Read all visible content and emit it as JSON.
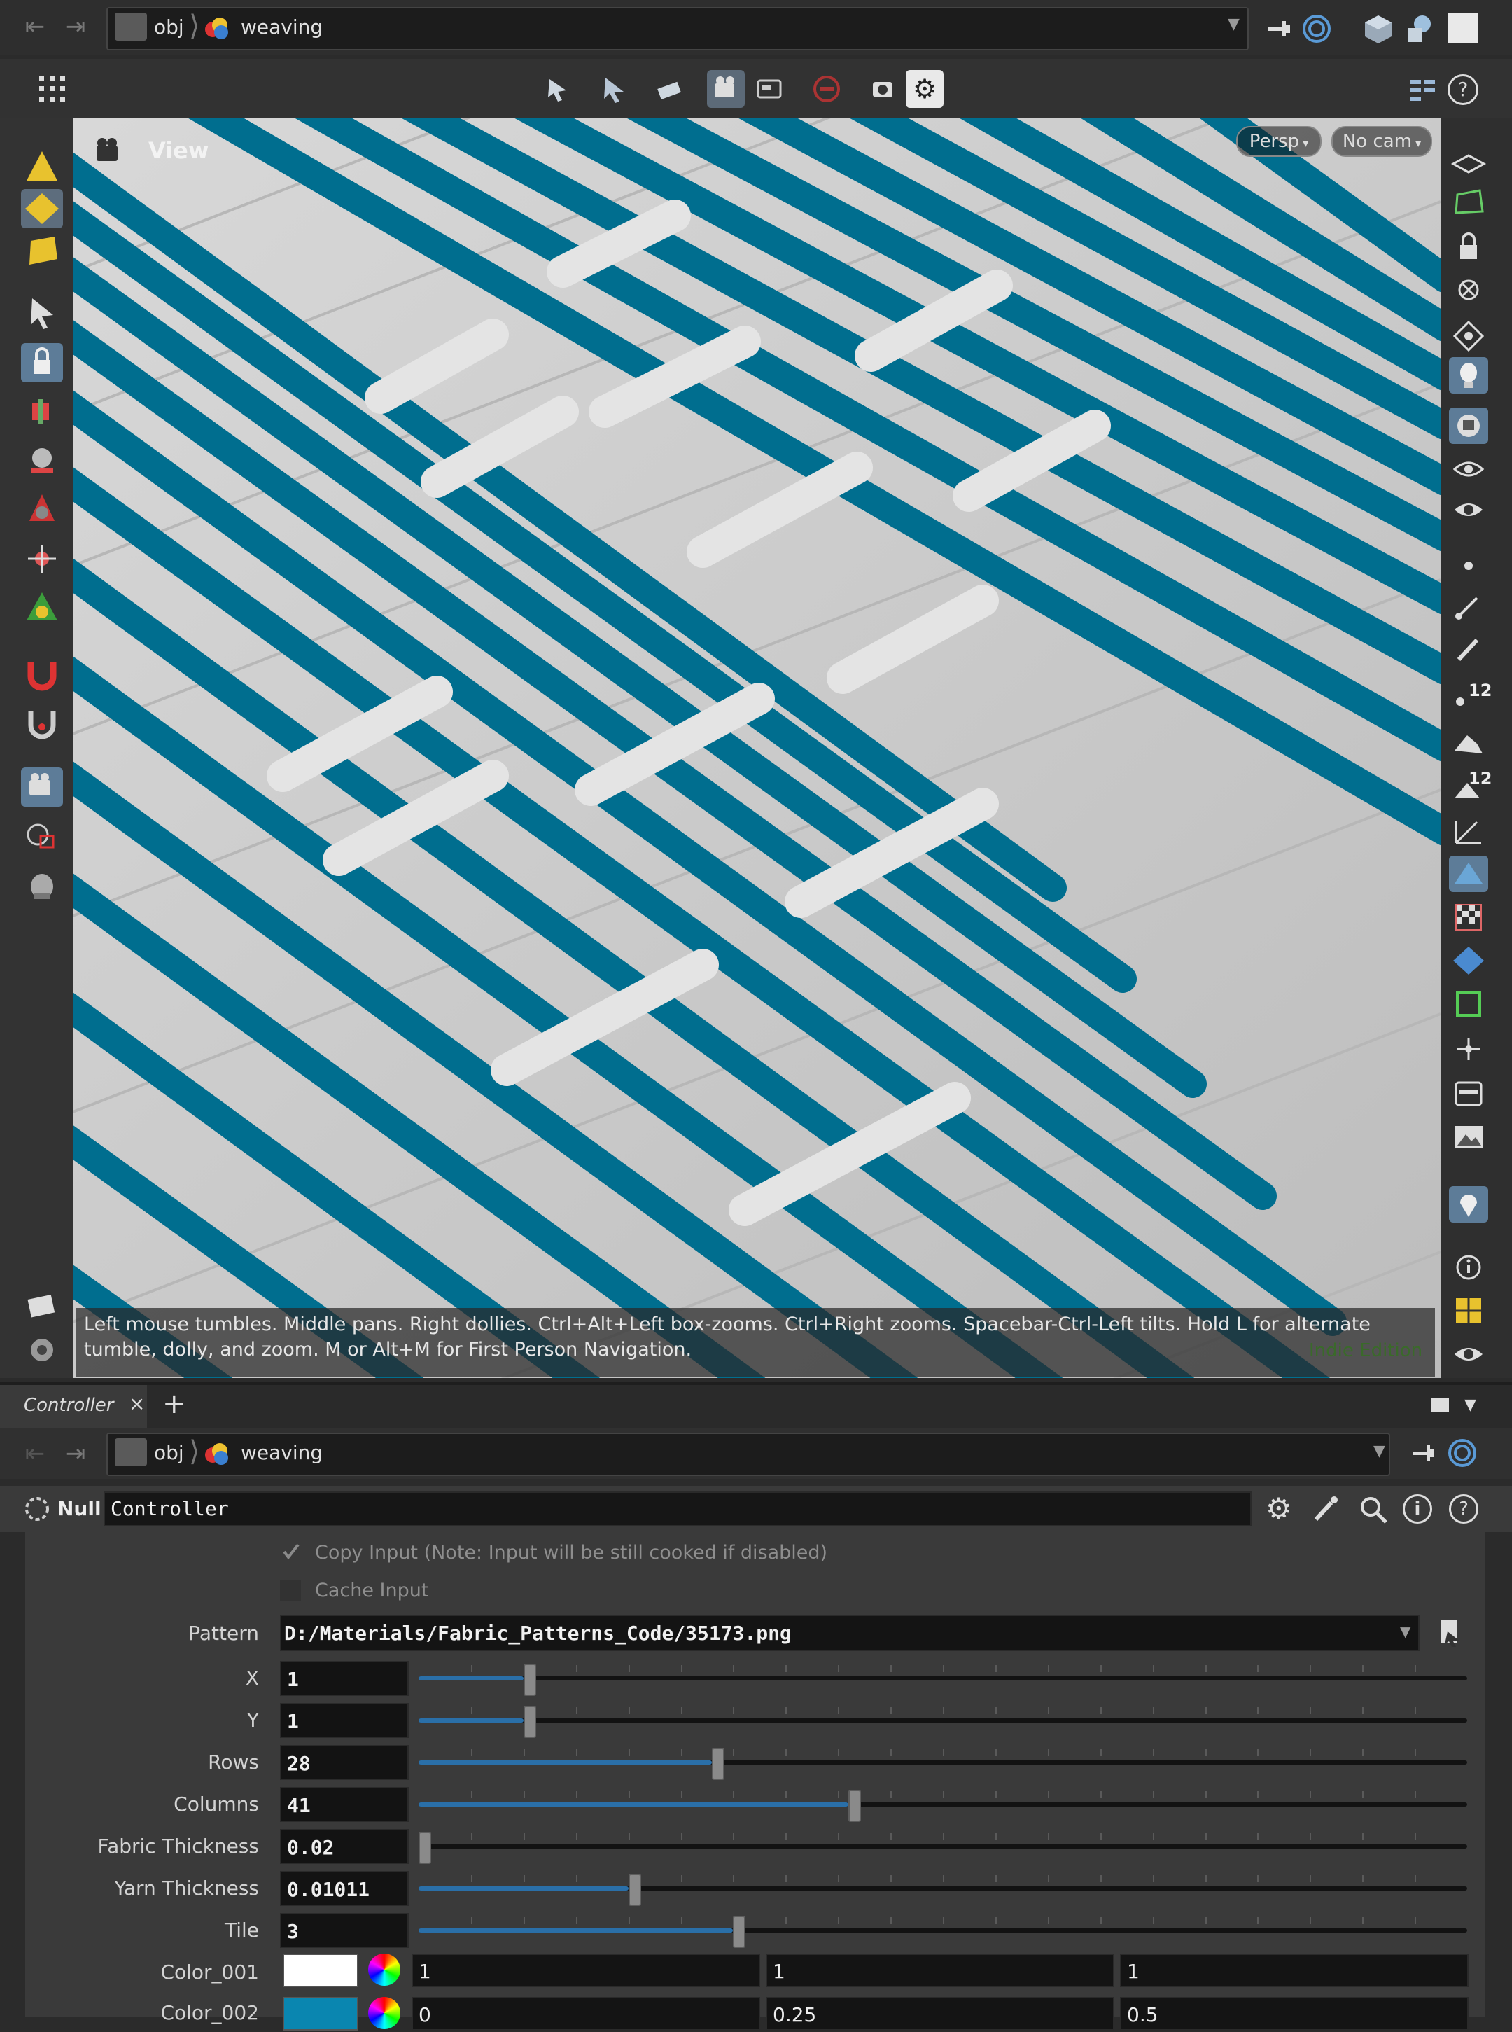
{
  "top_path": {
    "segment1": "obj",
    "segment2": "weaving"
  },
  "viewport": {
    "title": "View",
    "persp_label": "Persp",
    "cam_label": "No cam",
    "hint": "Left mouse tumbles. Middle pans. Right dollies. Ctrl+Alt+Left box-zooms. Ctrl+Right zooms. Spacebar-Ctrl-Left tilts. Hold L for alternate tumble, dolly, and zoom. M or Alt+M for First Person Navigation.",
    "watermark": "Indie Edition",
    "right_badge_1": "12",
    "right_badge_2": "12"
  },
  "colors": {
    "yarn_teal": "#006e8f",
    "yarn_white": "#e4e4e4",
    "accent": "#2a6fa8"
  },
  "panel": {
    "tab_label": "Controller",
    "path": {
      "segment1": "obj",
      "segment2": "weaving"
    },
    "node_type": "Null",
    "node_name": "Controller"
  },
  "params": {
    "copy_input": "Copy Input (Note: Input will be still cooked if disabled)",
    "cache_input": "Cache Input",
    "pattern_label": "Pattern",
    "pattern_value": "D:/Materials/Fabric_Patterns_Code/35173.png",
    "sliders": [
      {
        "label": "X",
        "value": "1",
        "fraction": 0.1
      },
      {
        "label": "Y",
        "value": "1",
        "fraction": 0.1
      },
      {
        "label": "Rows",
        "value": "28",
        "fraction": 0.28
      },
      {
        "label": "Columns",
        "value": "41",
        "fraction": 0.41
      },
      {
        "label": "Fabric Thickness",
        "value": "0.02",
        "fraction": 0.0
      },
      {
        "label": "Yarn Thickness",
        "value": "0.01011",
        "fraction": 0.2
      },
      {
        "label": "Tile",
        "value": "3",
        "fraction": 0.3
      }
    ],
    "color1": {
      "label": "Color_001",
      "swatch": "#ffffff",
      "r": "1",
      "g": "1",
      "b": "1"
    },
    "color2": {
      "label": "Color_002",
      "swatch": "#0a86b0",
      "r": "0",
      "g": "0.25",
      "b": "0.5"
    }
  }
}
